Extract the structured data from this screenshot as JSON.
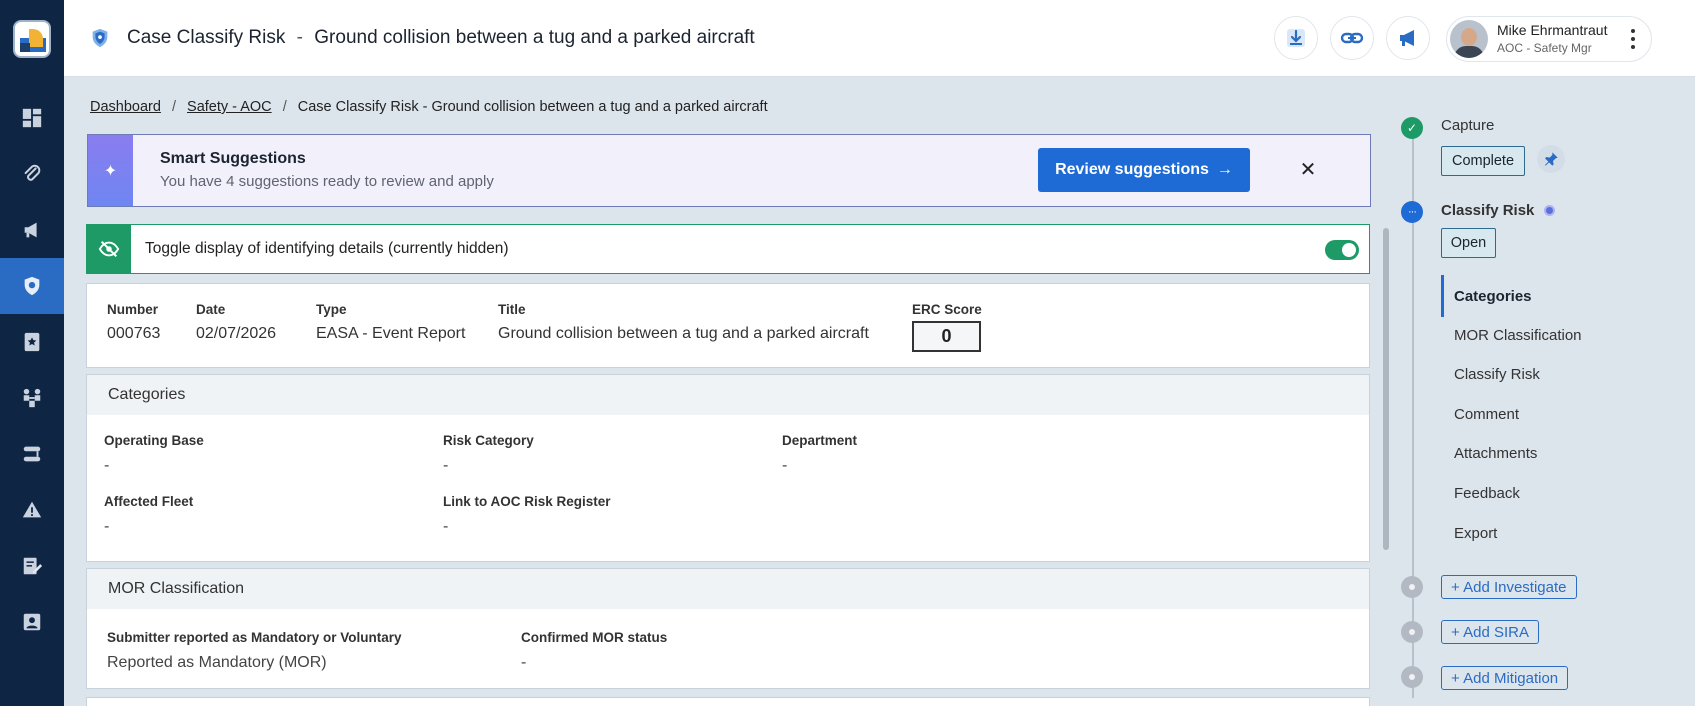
{
  "header": {
    "case_label": "Case",
    "stage_label": "Classify Risk",
    "separator": "-",
    "case_title": "Ground collision between a tug and a parked aircraft"
  },
  "user": {
    "name": "Mike Ehrmantraut",
    "role": "AOC - Safety Mgr"
  },
  "breadcrumb": {
    "items": [
      "Dashboard",
      "Safety - AOC"
    ],
    "current": "Case Classify Risk - Ground collision between a tug and a parked aircraft",
    "separator": "/"
  },
  "suggestions": {
    "title": "Smart Suggestions",
    "subtitle": "You have 4 suggestions ready to review and apply",
    "button_label": "Review suggestions",
    "button_arrow": "→",
    "sparkle": "✦",
    "close": "✕"
  },
  "privacy_toggle": {
    "label": "Toggle display of identifying details (currently hidden)",
    "on": true
  },
  "info": {
    "fields": [
      {
        "label": "Number",
        "value": "000763"
      },
      {
        "label": "Date",
        "value": "02/07/2026"
      },
      {
        "label": "Type",
        "value": "EASA - Event Report"
      },
      {
        "label": "Title",
        "value": "Ground collision between a tug and a parked aircraft"
      }
    ],
    "erc_label": "ERC Score",
    "erc_value": "0"
  },
  "categories": {
    "title": "Categories",
    "fields": [
      {
        "label": "Operating Base",
        "value": "-"
      },
      {
        "label": "Risk Category",
        "value": "-"
      },
      {
        "label": "Department",
        "value": "-"
      },
      {
        "label": "Affected Fleet",
        "value": "-"
      },
      {
        "label": "Link to AOC Risk Register",
        "value": "-"
      }
    ]
  },
  "mor": {
    "title": "MOR Classification",
    "fields": [
      {
        "label": "Submitter reported as Mandatory or Voluntary",
        "value": "Reported as Mandatory (MOR)"
      },
      {
        "label": "Confirmed MOR status",
        "value": "-"
      }
    ]
  },
  "workflow": {
    "capture": {
      "label": "Capture",
      "status": "Complete"
    },
    "classify": {
      "label": "Classify Risk",
      "status": "Open"
    },
    "subnav": [
      "Categories",
      "MOR Classification",
      "Classify Risk",
      "Comment",
      "Attachments",
      "Feedback",
      "Export"
    ],
    "add_buttons": [
      "+ Add Investigate",
      "+ Add SIRA",
      "+ Add Mitigation"
    ],
    "check_glyph": "✓",
    "open_glyph": "···"
  },
  "colors": {
    "sidebar": "#0f2544",
    "accent": "#1e6bd6",
    "success": "#1e9a66",
    "suggestions_bg": "#f1f0fb"
  }
}
